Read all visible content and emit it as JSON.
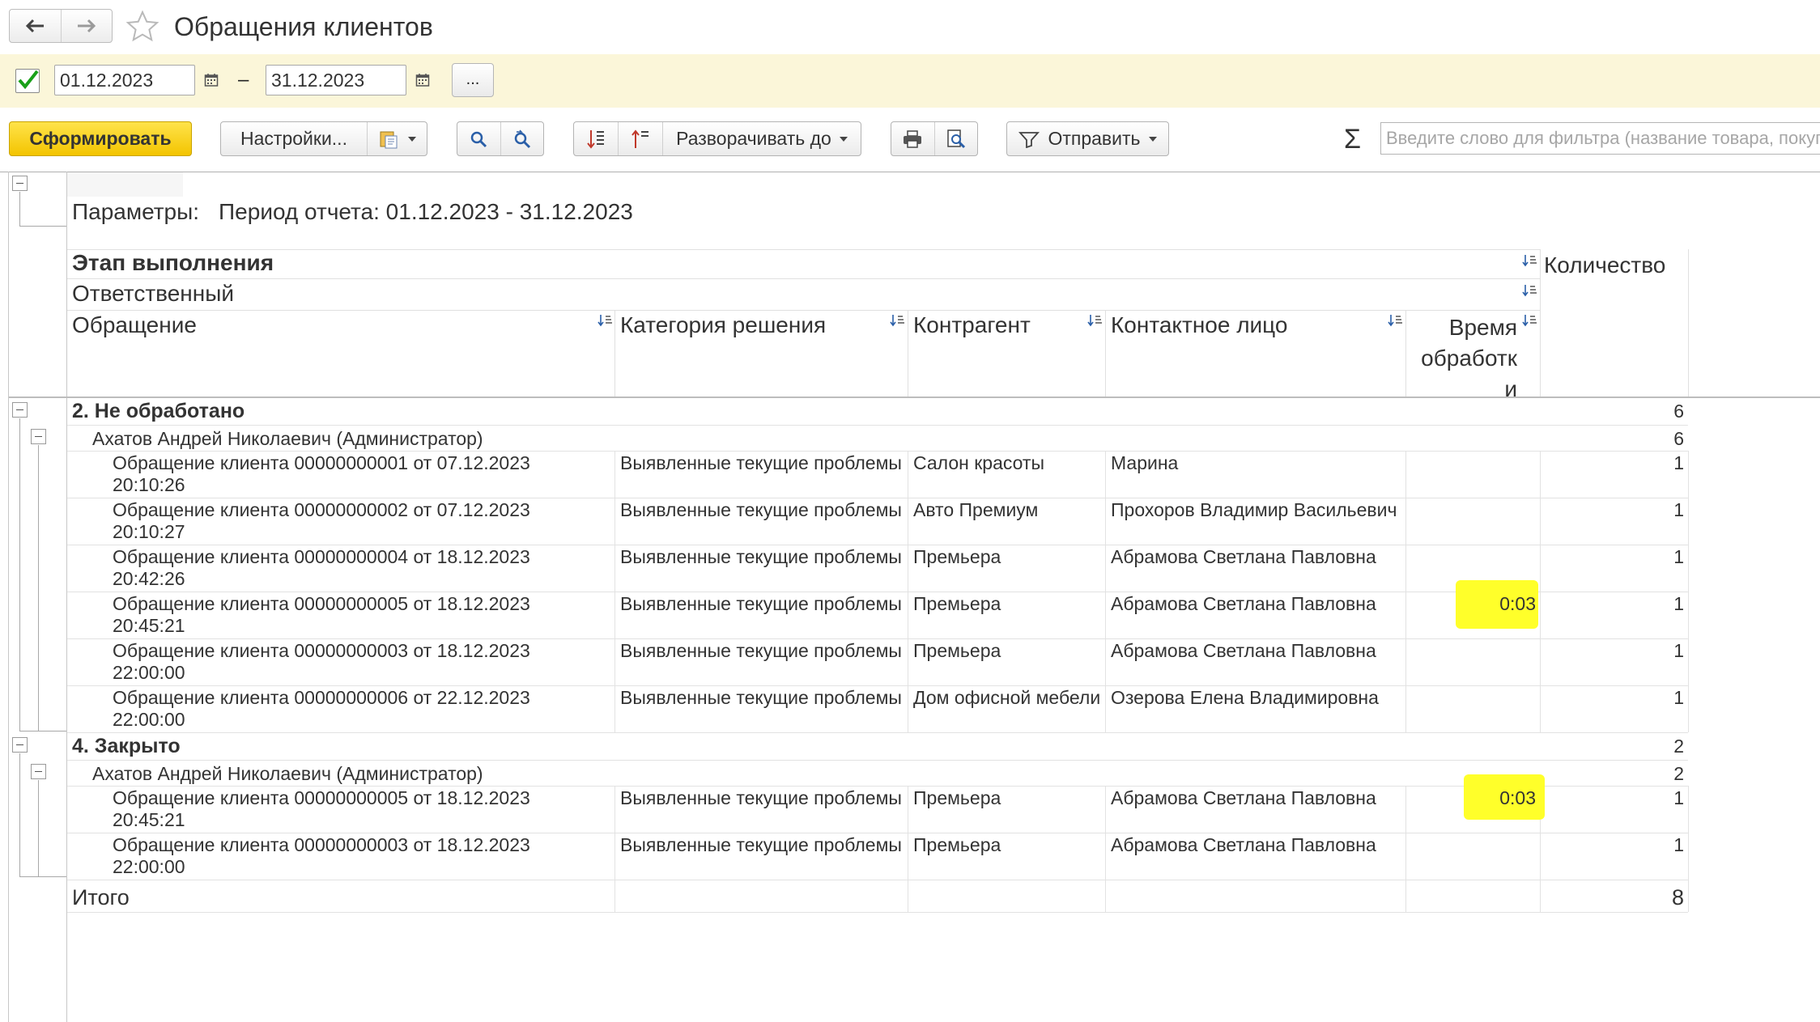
{
  "window": {
    "title": "Обращения клиентов"
  },
  "period": {
    "enabled": true,
    "from": "01.12.2023",
    "separator": "–",
    "to": "31.12.2023",
    "more_label": "..."
  },
  "toolbar": {
    "generate": "Сформировать",
    "settings": "Настройки...",
    "expand_to": "Разворачивать до",
    "send": "Отправить",
    "sigma": "Σ",
    "filter_placeholder": "Введите слово для фильтра (название товара, покупателя)"
  },
  "report": {
    "params_label": "Параметры:",
    "params_value": "Период отчета: 01.12.2023 - 31.12.2023",
    "headers": {
      "stage": "Этап выполнения",
      "responsible": "Ответственный",
      "request": "Обращение",
      "category": "Категория решения",
      "counterparty": "Контрагент",
      "contact": "Контактное лицо",
      "time_l1": "Время",
      "time_l2": "обработк",
      "time_l3": "и",
      "count": "Количество"
    },
    "groups": [
      {
        "stage": "2. Не обработано",
        "count": "6",
        "responsible": "Ахатов Андрей Николаевич (Администратор)",
        "resp_count": "6",
        "rows": [
          {
            "req1": "Обращение клиента 00000000001 от 07.12.2023",
            "req2": "20:10:26",
            "category": "Выявленные текущие проблемы",
            "counterparty": "Салон красоты",
            "contact": "Марина",
            "time": "",
            "count": "1"
          },
          {
            "req1": "Обращение клиента 00000000002 от 07.12.2023",
            "req2": "20:10:27",
            "category": "Выявленные текущие проблемы",
            "counterparty": "Авто Премиум",
            "contact": "Прохоров Владимир Васильевич",
            "time": "",
            "count": "1"
          },
          {
            "req1": "Обращение клиента 00000000004 от 18.12.2023",
            "req2": "20:42:26",
            "category": "Выявленные текущие проблемы",
            "counterparty": "Премьера",
            "contact": "Абрамова Светлана Павловна",
            "time": "",
            "count": "1"
          },
          {
            "req1": "Обращение клиента 00000000005 от 18.12.2023",
            "req2": "20:45:21",
            "category": "Выявленные текущие проблемы",
            "counterparty": "Премьера",
            "contact": "Абрамова Светлана Павловна",
            "time": "0:03",
            "count": "1"
          },
          {
            "req1": "Обращение клиента 00000000003 от 18.12.2023",
            "req2": "22:00:00",
            "category": "Выявленные текущие проблемы",
            "counterparty": "Премьера",
            "contact": "Абрамова Светлана Павловна",
            "time": "",
            "count": "1"
          },
          {
            "req1": "Обращение клиента 00000000006 от 22.12.2023",
            "req2": "22:00:00",
            "category": "Выявленные текущие проблемы",
            "counterparty": "Дом офисной мебели",
            "contact": "Озерова Елена Владимировна",
            "time": "",
            "count": "1"
          }
        ]
      },
      {
        "stage": "4. Закрыто",
        "count": "2",
        "responsible": "Ахатов Андрей Николаевич (Администратор)",
        "resp_count": "2",
        "rows": [
          {
            "req1": "Обращение клиента 00000000005 от 18.12.2023",
            "req2": "20:45:21",
            "category": "Выявленные текущие проблемы",
            "counterparty": "Премьера",
            "contact": "Абрамова Светлана Павловна",
            "time": "0:03",
            "count": "1"
          },
          {
            "req1": "Обращение клиента 00000000003 от 18.12.2023",
            "req2": "22:00:00",
            "category": "Выявленные текущие проблемы",
            "counterparty": "Премьера",
            "contact": "Абрамова Светлана Павловна",
            "time": "",
            "count": "1"
          }
        ]
      }
    ],
    "total_label": "Итого",
    "total_count": "8"
  },
  "highlight_color": "#ffff2a"
}
